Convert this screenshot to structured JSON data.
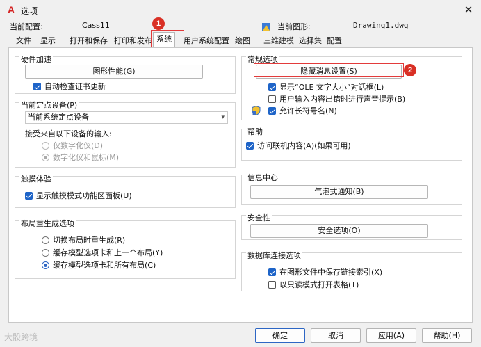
{
  "window": {
    "title": "选项",
    "close_glyph": "✕",
    "logo_glyph": "A"
  },
  "profile": {
    "current_config_label": "当前配置:",
    "current_config_value": "Cass11",
    "current_drawing_label": "当前图形:",
    "current_drawing_value": "Drawing1.dwg"
  },
  "tabs": [
    {
      "label": "文件"
    },
    {
      "label": "显示"
    },
    {
      "label": "打开和保存"
    },
    {
      "label": "打印和发布"
    },
    {
      "label": "系统"
    },
    {
      "label": "用户系统配置"
    },
    {
      "label": "绘图"
    },
    {
      "label": "三维建模"
    },
    {
      "label": "选择集"
    },
    {
      "label": "配置"
    }
  ],
  "hardware": {
    "title": "硬件加速",
    "perf_button": "图形性能(G)",
    "auto_check_label": "自动检查证书更新"
  },
  "pointing": {
    "title": "当前定点设备(P)",
    "device_value": "当前系统定点设备",
    "accept_label": "接受来自以下设备的输入:",
    "digitizer_only": "仅数字化仪(D)",
    "digitizer_and_mouse": "数字化仪和鼠标(M)"
  },
  "touch": {
    "title": "触摸体验",
    "show_ribbon_panel": "显示触摸模式功能区面板(U)"
  },
  "layout_regen": {
    "title": "布局重生成选项",
    "options": [
      "切换布局时重生成(R)",
      "缓存模型选项卡和上一个布局(Y)",
      "缓存模型选项卡和所有布局(C)"
    ]
  },
  "general": {
    "title": "常规选项",
    "hidden_msg_button": "隐藏消息设置(S)",
    "show_ole_dialog": "显示“OLE 文字大小”对话框(L)",
    "beep_on_error": "用户输入内容出错时进行声音提示(B)",
    "allow_long_names": "允许长符号名(N)"
  },
  "help": {
    "title": "帮助",
    "access_online": "访问联机内容(A)(如果可用)"
  },
  "info_center": {
    "title": "信息中心",
    "balloon_button": "气泡式通知(B)"
  },
  "security": {
    "title": "安全性",
    "options_button": "安全选项(O)"
  },
  "db_connect": {
    "title": "数据库连接选项",
    "save_link_index": "在图形文件中保存链接索引(X)",
    "open_readonly": "以只读模式打开表格(T)"
  },
  "annotations": {
    "badge_1": "1",
    "badge_2": "2"
  },
  "buttons": {
    "ok": "确定",
    "cancel": "取消",
    "apply": "应用(A)",
    "help": "帮助(H)"
  },
  "watermark": "大骰跨境",
  "colors": {
    "accent": "#1e64c8",
    "marker": "#e23a3a",
    "badge": "#d93025",
    "logo": "#d42020"
  },
  "icons": {
    "logo": "autocad-logo-icon",
    "drawing": "drawing-file-icon",
    "long_names_shield": "shield-icon",
    "close": "close-icon"
  }
}
